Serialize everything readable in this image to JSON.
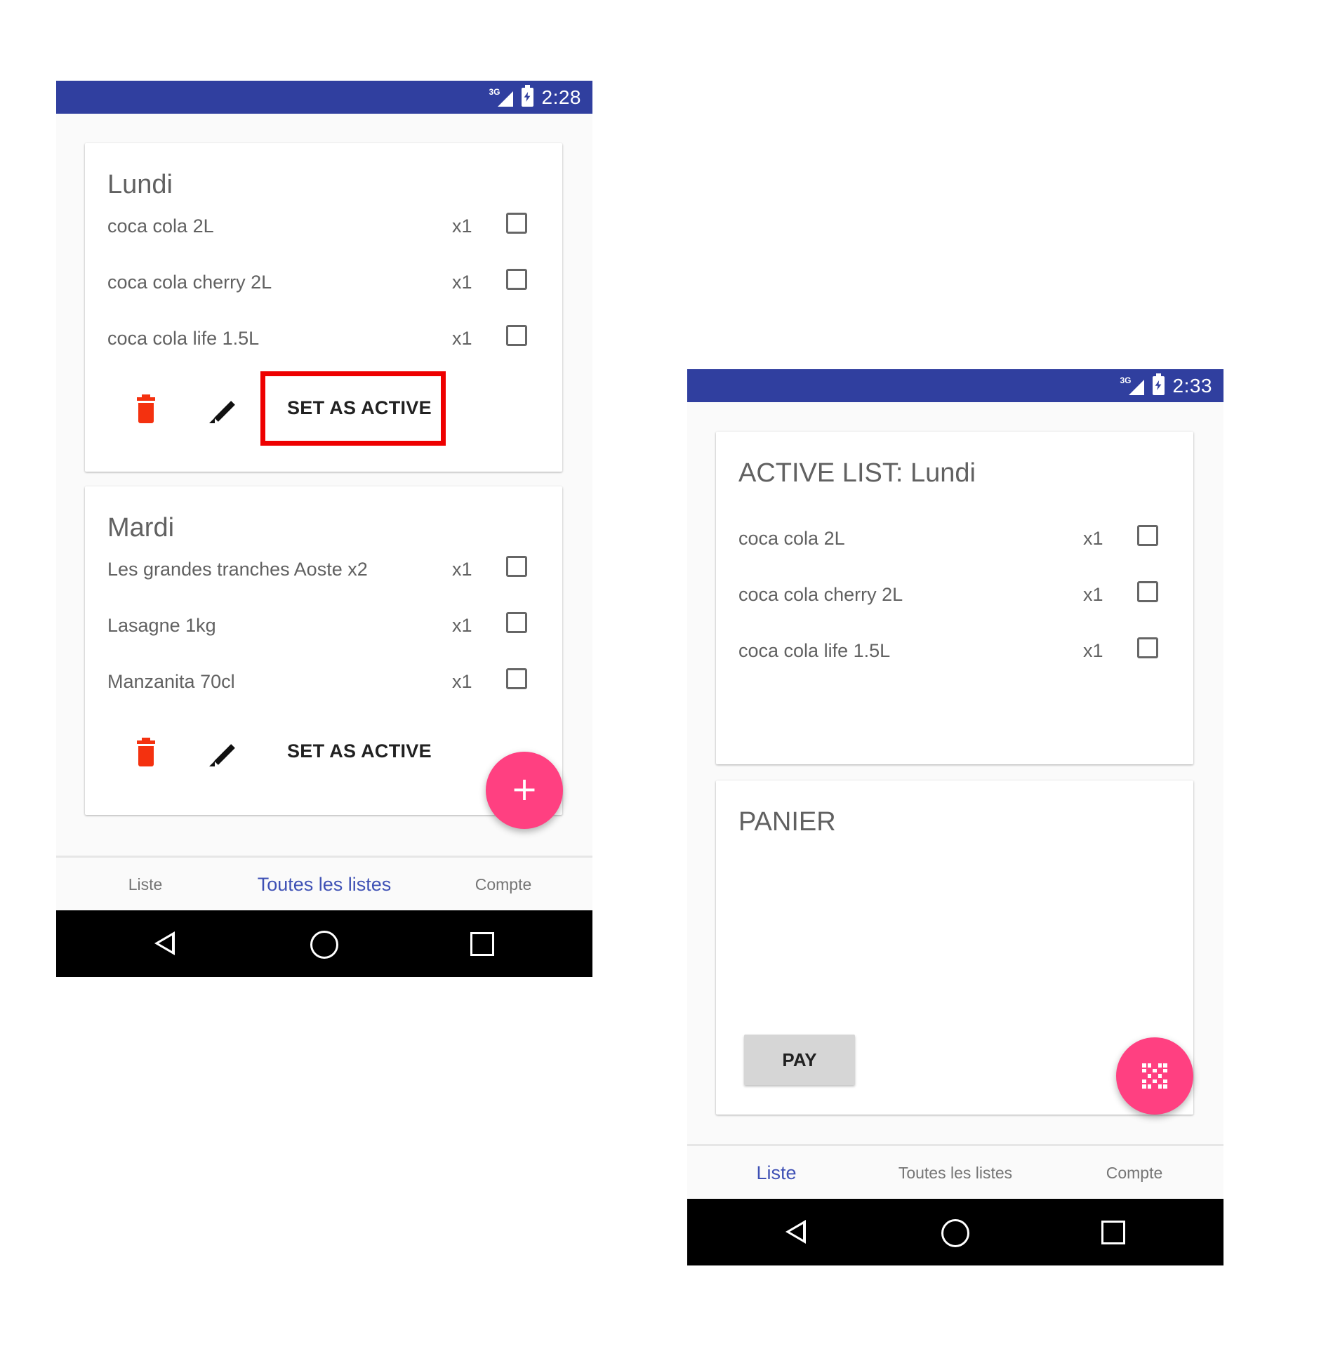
{
  "left_screen": {
    "status_bar": {
      "network": "3G",
      "time": "2:28"
    },
    "cards": [
      {
        "title": "Lundi",
        "items": [
          {
            "name": "coca cola 2L",
            "qty": "x1",
            "checked": false
          },
          {
            "name": "coca cola cherry 2L",
            "qty": "x1",
            "checked": false
          },
          {
            "name": "coca cola life 1.5L",
            "qty": "x1",
            "checked": false
          }
        ],
        "action_label": "SET AS ACTIVE",
        "highlighted": true
      },
      {
        "title": "Mardi",
        "items": [
          {
            "name": "Les grandes tranches Aoste x2",
            "qty": "x1",
            "checked": false
          },
          {
            "name": "Lasagne 1kg",
            "qty": "x1",
            "checked": false
          },
          {
            "name": "Manzanita 70cl",
            "qty": "x1",
            "checked": false
          }
        ],
        "action_label": "SET AS ACTIVE",
        "highlighted": false
      }
    ],
    "fab_icon": "plus-icon",
    "fab_symbol": "+",
    "tabs": [
      {
        "label": "Liste",
        "active": false
      },
      {
        "label": "Toutes les listes",
        "active": true
      },
      {
        "label": "Compte",
        "active": false
      }
    ]
  },
  "right_screen": {
    "status_bar": {
      "network": "3G",
      "time": "2:33"
    },
    "active_card": {
      "title": "ACTIVE LIST: Lundi",
      "items": [
        {
          "name": "coca cola 2L",
          "qty": "x1",
          "checked": false
        },
        {
          "name": "coca cola cherry 2L",
          "qty": "x1",
          "checked": false
        },
        {
          "name": "coca cola life 1.5L",
          "qty": "x1",
          "checked": false
        }
      ]
    },
    "basket_card": {
      "title": "PANIER",
      "pay_label": "PAY"
    },
    "fab_icon": "qr-code-icon",
    "tabs": [
      {
        "label": "Liste",
        "active": true
      },
      {
        "label": "Toutes les listes",
        "active": false
      },
      {
        "label": "Compte",
        "active": false
      }
    ]
  },
  "colors": {
    "primary": "#303f9f",
    "accent": "#ff4081",
    "tab_active": "#3f51b5",
    "delete": "#f4310f",
    "highlight": "#ee0000"
  },
  "icons": {
    "delete": "trash-icon",
    "edit": "pencil-icon",
    "back": "back-triangle-icon",
    "home": "home-circle-icon",
    "recent": "recent-apps-icon",
    "battery": "battery-charging-icon",
    "signal": "signal-icon"
  }
}
